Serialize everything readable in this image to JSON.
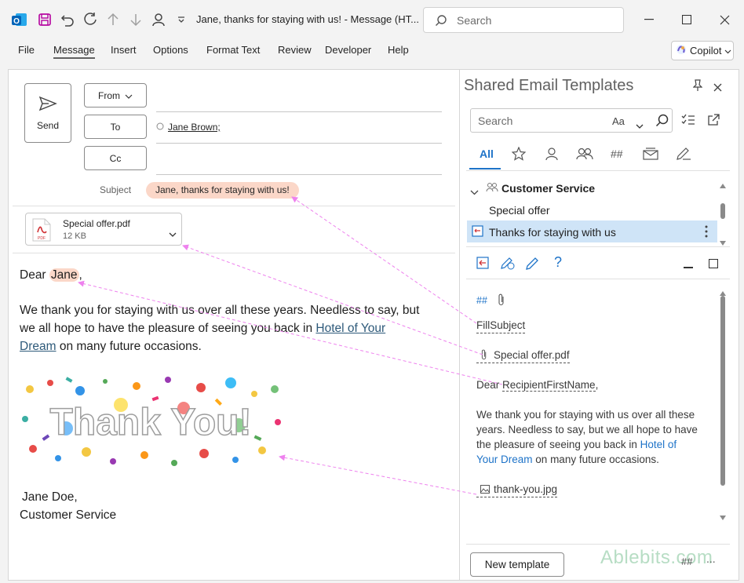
{
  "window": {
    "title": "Jane, thanks for staying with us!  -  Message (HT...",
    "search_placeholder": "Search"
  },
  "menu": {
    "items": [
      "File",
      "Message",
      "Insert",
      "Options",
      "Format Text",
      "Review",
      "Developer",
      "Help"
    ],
    "active": "Message",
    "copilot_label": "Copilot"
  },
  "compose": {
    "send_label": "Send",
    "from_label": "From",
    "to_label": "To",
    "cc_label": "Cc",
    "recipient": "Jane Brown;",
    "subject_label": "Subject",
    "subject_value": "Jane, thanks for staying with us!",
    "attachment": {
      "name": "Special offer.pdf",
      "size": "12 KB",
      "type_label": "PDF"
    },
    "body": {
      "greeting_prefix": "Dear ",
      "greeting_name": "Jane",
      "greeting_suffix": ",",
      "para_line1": "We thank you for staying with us over all these years. Needless to say, but",
      "para_line2_prefix": "we all hope to have the pleasure of seeing you back in ",
      "link_part1": "Hotel of Your",
      "link_part2": "Dream",
      "para_line3_suffix": " on many future occasions.",
      "image_text": "Thank You!",
      "signature_name": "Jane Doe,",
      "signature_dept": "Customer Service"
    }
  },
  "pane": {
    "title": "Shared Email Templates",
    "search_placeholder": "Search",
    "case_label": "Aa",
    "tabs": {
      "all": "All",
      "hash": "##"
    },
    "folder": "Customer Service",
    "templates": [
      "Special offer",
      "Thanks for staying with us"
    ],
    "selected_template": "Thanks for staying with us",
    "help_glyph": "?",
    "preview": {
      "hash_marker": "##",
      "fill_subject": "FillSubject",
      "attachment": "Special offer.pdf",
      "dear": "Dear ",
      "first_name_macro": "RecipientFirstName",
      "comma": ",",
      "line1": "We thank you for staying with us over all these",
      "line2": "years. Needless to say, but we all hope to have",
      "line3_prefix": "the pleasure of seeing you back in ",
      "link1": "Hotel of",
      "link2": "Your Dream",
      "line4_suffix": " on many future occasions.",
      "image": "thank-you.jpg"
    },
    "new_template_label": "New template",
    "footer_hash": "##",
    "footer_more": "...",
    "watermark": "Ablebits.com"
  },
  "colors": {
    "highlight": "#fbd7c8",
    "selection": "#cfe4f7",
    "accent": "#1e73c8",
    "arrow": "#ee82ee"
  }
}
